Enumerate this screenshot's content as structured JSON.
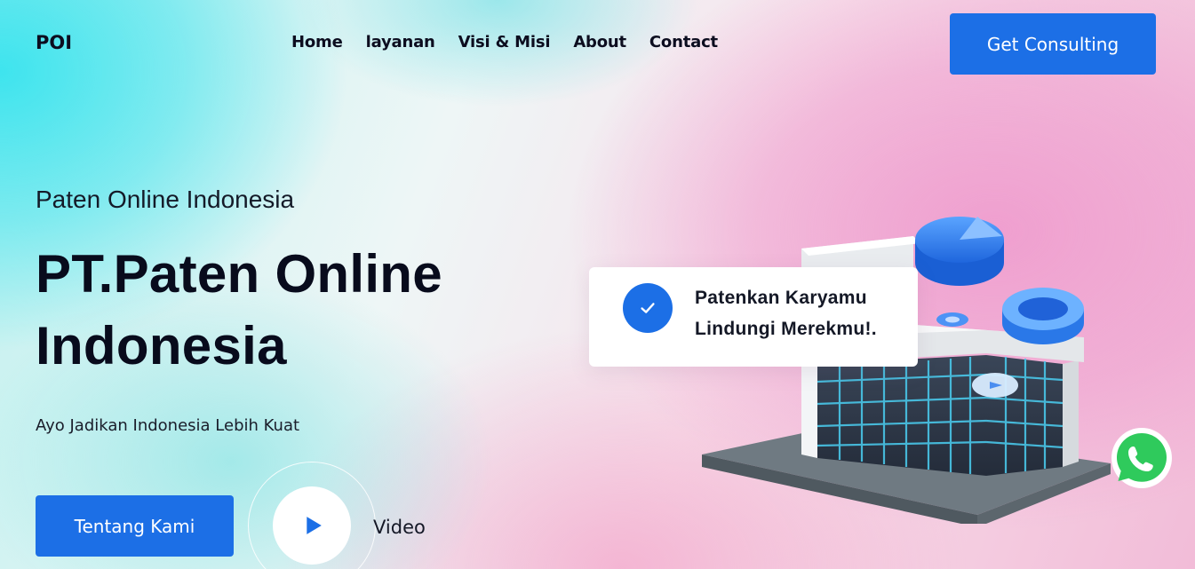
{
  "header": {
    "logo": "POI",
    "nav": [
      {
        "label": "Home"
      },
      {
        "label": "layanan"
      },
      {
        "label": "Visi & Misi"
      },
      {
        "label": "About"
      },
      {
        "label": "Contact"
      }
    ],
    "cta_label": "Get Consulting"
  },
  "hero": {
    "subtitle": "Paten Online Indonesia",
    "headline_line1": "PT.Paten Online",
    "headline_line2": "Indonesia",
    "tagline": "Ayo Jadikan Indonesia Lebih Kuat",
    "primary_button": "Tentang Kami",
    "video_label": "Video"
  },
  "card": {
    "line1": "Patenkan Karyamu",
    "line2": "Lindungi Merekmu!."
  },
  "icons": {
    "play": "play-icon",
    "check": "check-icon",
    "whatsapp": "whatsapp-icon"
  },
  "colors": {
    "accent": "#1c6fe6",
    "text_dark": "#080b1c",
    "whatsapp": "#25d366"
  }
}
